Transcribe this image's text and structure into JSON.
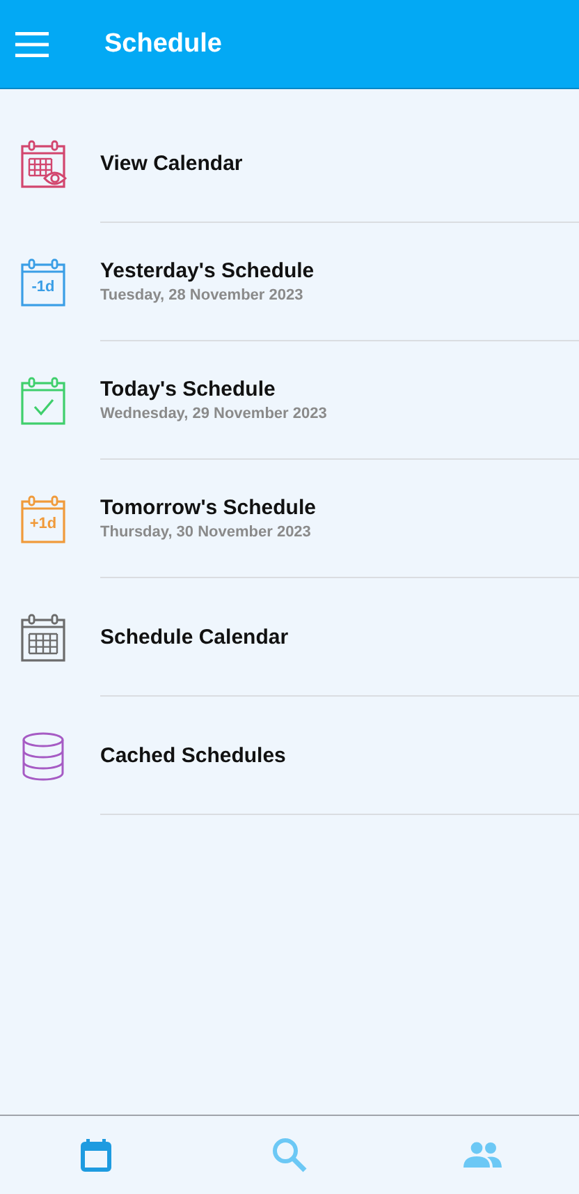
{
  "app_bar": {
    "title": "Schedule"
  },
  "items": [
    {
      "kind": "eye",
      "color": "#d2466e",
      "title": "View Calendar"
    },
    {
      "kind": "badge",
      "color": "#3a9ee6",
      "badge": "-1d",
      "title": "Yesterday's Schedule",
      "subtitle": "Tuesday, 28 November 2023"
    },
    {
      "kind": "check",
      "color": "#3fcf6c",
      "title": "Today's Schedule",
      "subtitle": "Wednesday, 29 November 2023"
    },
    {
      "kind": "badge",
      "color": "#f09a3a",
      "badge": "+1d",
      "title": "Tomorrow's Schedule",
      "subtitle": "Thursday, 30 November 2023"
    },
    {
      "kind": "grid",
      "color": "#6b6b6b",
      "title": "Schedule Calendar"
    },
    {
      "kind": "database",
      "color": "#a65bc4",
      "title": "Cached Schedules"
    }
  ],
  "bottom_nav": [
    {
      "kind": "calendar",
      "selected": true
    },
    {
      "kind": "search",
      "selected": false
    },
    {
      "kind": "people",
      "selected": false
    }
  ]
}
